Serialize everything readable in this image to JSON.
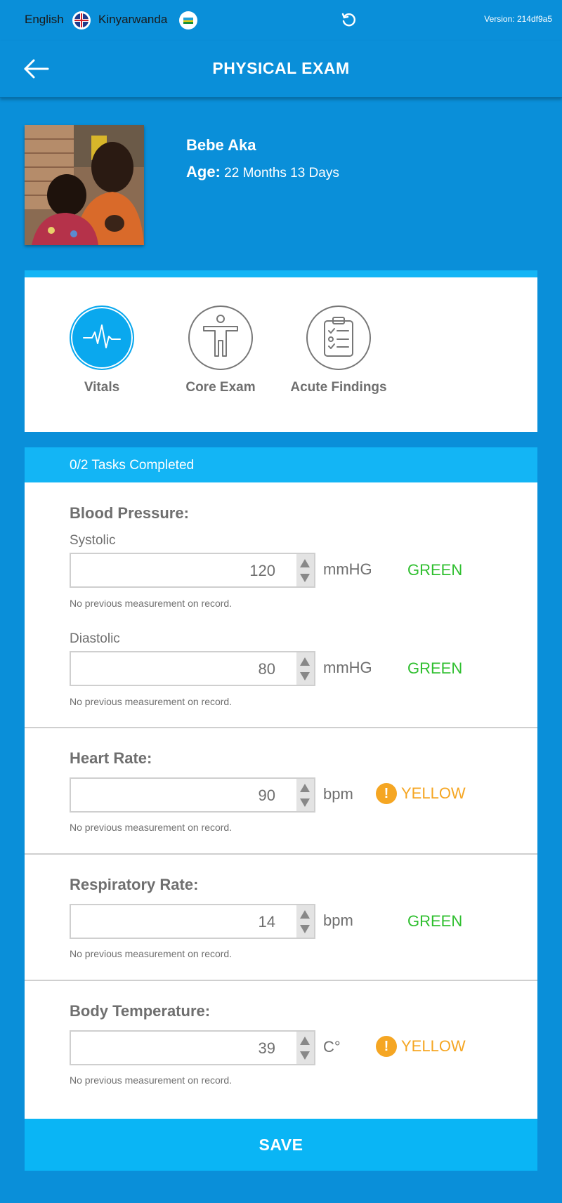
{
  "topbar": {
    "lang_english": "English",
    "lang_kinyarwanda": "Kinyarwanda",
    "version": "Version: 214df9a5"
  },
  "header": {
    "title": "PHYSICAL EXAM"
  },
  "patient": {
    "name": "Bebe Aka",
    "age_label": "Age:",
    "age_value": "22 Months 13 Days"
  },
  "tabs": [
    {
      "label": "Vitals",
      "active": true,
      "icon": "heartbeat-icon"
    },
    {
      "label": "Core Exam",
      "active": false,
      "icon": "body-icon"
    },
    {
      "label": "Acute Findings",
      "active": false,
      "icon": "clipboard-icon"
    }
  ],
  "tasks": {
    "status": "0/2 Tasks Completed"
  },
  "vitals": {
    "blood_pressure": {
      "title": "Blood Pressure:",
      "systolic": {
        "label": "Systolic",
        "value": "120",
        "unit": "mmHG",
        "status": "GREEN",
        "note": "No previous measurement on record."
      },
      "diastolic": {
        "label": "Diastolic",
        "value": "80",
        "unit": "mmHG",
        "status": "GREEN",
        "note": "No previous measurement on record."
      }
    },
    "heart_rate": {
      "title": "Heart Rate:",
      "value": "90",
      "unit": "bpm",
      "status": "YELLOW",
      "note": "No previous measurement on record."
    },
    "respiratory_rate": {
      "title": "Respiratory Rate:",
      "value": "14",
      "unit": "bpm",
      "status": "GREEN",
      "note": "No previous measurement on record."
    },
    "body_temperature": {
      "title": "Body Temperature:",
      "value": "39",
      "unit": "C°",
      "status": "YELLOW",
      "note": "No previous measurement on record."
    }
  },
  "actions": {
    "save_label": "SAVE"
  },
  "colors": {
    "primary": "#0A8FD9",
    "accent": "#13B5F5",
    "green": "#2FBF2F",
    "yellow": "#F5A623"
  }
}
